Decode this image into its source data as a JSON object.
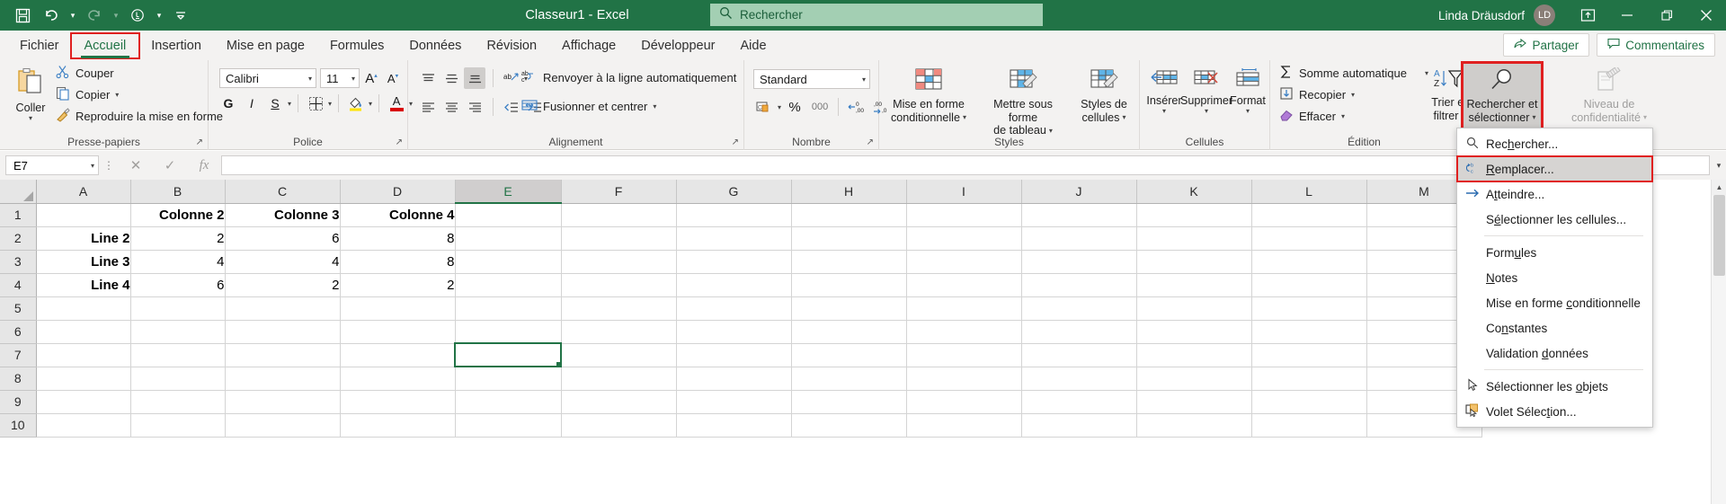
{
  "titlebar": {
    "quick_access": [
      {
        "name": "save-icon",
        "glyph": "὚B"
      },
      {
        "name": "undo-icon",
        "glyph": "↶"
      },
      {
        "name": "redo-icon",
        "glyph": "↷"
      },
      {
        "name": "touch-mode-icon",
        "glyph": "☝"
      },
      {
        "name": "customize-qat-icon",
        "glyph": "⌄"
      }
    ],
    "document_title": "Classeur1  -  Excel",
    "search_placeholder": "Rechercher",
    "user_name": "Linda Dräusdorf",
    "user_initials": "LD",
    "window_buttons": [
      "ribbon-display",
      "minimize",
      "restore",
      "close"
    ]
  },
  "tabs": [
    {
      "label": "Fichier",
      "active": false,
      "highlighted": false
    },
    {
      "label": "Accueil",
      "active": true,
      "highlighted": true
    },
    {
      "label": "Insertion",
      "active": false,
      "highlighted": false
    },
    {
      "label": "Mise en page",
      "active": false,
      "highlighted": false
    },
    {
      "label": "Formules",
      "active": false,
      "highlighted": false
    },
    {
      "label": "Données",
      "active": false,
      "highlighted": false
    },
    {
      "label": "Révision",
      "active": false,
      "highlighted": false
    },
    {
      "label": "Affichage",
      "active": false,
      "highlighted": false
    },
    {
      "label": "Développeur",
      "active": false,
      "highlighted": false
    },
    {
      "label": "Aide",
      "active": false,
      "highlighted": false
    }
  ],
  "tab_actions": {
    "share_label": "Partager",
    "comments_label": "Commentaires"
  },
  "ribbon": {
    "clipboard": {
      "group_label": "Presse-papiers",
      "paste_label": "Coller",
      "cut_label": "Couper",
      "copy_label": "Copier",
      "format_painter_label": "Reproduire la mise en forme"
    },
    "font": {
      "group_label": "Police",
      "font_family": "Calibri",
      "font_size": "11",
      "grow_font": "A",
      "shrink_font": "A",
      "bold": "G",
      "italic": "I",
      "underline": "S",
      "borders": "borders-icon",
      "fill_color": "fill-color-icon",
      "font_color": "A"
    },
    "alignment": {
      "group_label": "Alignement",
      "wrap_text_label": "Renvoyer à la ligne automatiquement",
      "merge_label": "Fusionner et centrer"
    },
    "number": {
      "group_label": "Nombre",
      "format": "Standard",
      "percent": "%",
      "thousands": "000",
      "decrease_decimal": "decrease-decimal-icon",
      "increase_decimal": "increase-decimal-icon"
    },
    "styles": {
      "group_label": "Styles",
      "conditional_formatting": "Mise en forme\nconditionnelle",
      "conditional_formatting_l1": "Mise en forme",
      "conditional_formatting_l2": "conditionnelle",
      "format_as_table_l1": "Mettre sous forme",
      "format_as_table_l2": "de tableau",
      "cell_styles_l1": "Styles de",
      "cell_styles_l2": "cellules"
    },
    "cells": {
      "group_label": "Cellules",
      "insert_label": "Insérer",
      "delete_label": "Supprimer",
      "format_label": "Format"
    },
    "editing": {
      "group_label": "Édition",
      "autosum_label": "Somme automatique",
      "fill_label": "Recopier",
      "clear_label": "Effacer",
      "sort_filter_l1": "Trier et",
      "sort_filter_l2": "filtrer",
      "find_select_l1": "Rechercher et",
      "find_select_l2": "sélectionner"
    },
    "sensitivity": {
      "label_l1": "Niveau de",
      "label_l2": "confidentialité"
    }
  },
  "formula_bar": {
    "name_box_value": "E7",
    "cancel_icon": "✕",
    "confirm_icon": "✓",
    "function_icon": "fx",
    "formula_value": ""
  },
  "find_menu": {
    "items": [
      {
        "label": "Rechercher...",
        "icon": "search-icon",
        "highlighted": false,
        "separator_after": false
      },
      {
        "label": "Remplacer...",
        "icon": "replace-icon",
        "highlighted": true,
        "separator_after": false
      },
      {
        "label": "Atteindre...",
        "icon": "goto-arrow-icon",
        "highlighted": false,
        "separator_after": false
      },
      {
        "label": "Sélectionner les cellules...",
        "icon": "",
        "highlighted": false,
        "separator_after": true
      },
      {
        "label": "Formules",
        "icon": "",
        "highlighted": false,
        "separator_after": false
      },
      {
        "label": "Notes",
        "icon": "",
        "highlighted": false,
        "separator_after": false
      },
      {
        "label": "Mise en forme conditionnelle",
        "icon": "",
        "highlighted": false,
        "separator_after": false
      },
      {
        "label": "Constantes",
        "icon": "",
        "highlighted": false,
        "separator_after": false
      },
      {
        "label": "Validation données",
        "icon": "",
        "highlighted": false,
        "separator_after": true
      },
      {
        "label": "Sélectionner les objets",
        "icon": "pointer-icon",
        "highlighted": false,
        "separator_after": false
      },
      {
        "label": "Volet Sélection...",
        "icon": "selection-pane-icon",
        "highlighted": false,
        "separator_after": false
      }
    ]
  },
  "grid": {
    "columns": [
      "A",
      "B",
      "C",
      "D",
      "E",
      "F",
      "G",
      "H",
      "I",
      "J",
      "K",
      "L",
      "M"
    ],
    "active_column": "E",
    "rows": [
      "1",
      "2",
      "3",
      "4",
      "5",
      "6",
      "7",
      "8",
      "9",
      "10"
    ],
    "selected_cell": "E7",
    "cells": [
      {
        "row": "1",
        "A": "",
        "B": "Colonne 2",
        "C": "Colonne 3",
        "D": "Colonne 4"
      },
      {
        "row": "2",
        "A": "Line 2",
        "B": "2",
        "C": "6",
        "D": "8"
      },
      {
        "row": "3",
        "A": "Line 3",
        "B": "4",
        "C": "4",
        "D": "8"
      },
      {
        "row": "4",
        "A": "Line 4",
        "B": "6",
        "C": "2",
        "D": "2"
      },
      {
        "row": "5",
        "A": "",
        "B": "",
        "C": "",
        "D": ""
      },
      {
        "row": "6",
        "A": "",
        "B": "",
        "C": "",
        "D": ""
      },
      {
        "row": "7",
        "A": "",
        "B": "",
        "C": "",
        "D": ""
      },
      {
        "row": "8",
        "A": "",
        "B": "",
        "C": "",
        "D": ""
      },
      {
        "row": "9",
        "A": "",
        "B": "",
        "C": "",
        "D": ""
      },
      {
        "row": "10",
        "A": "",
        "B": "",
        "C": "",
        "D": ""
      }
    ]
  },
  "colors": {
    "excel_green": "#217346",
    "ribbon_bg": "#f3f2f1",
    "highlight_red": "#e02020",
    "search_bg": "#a3cfb3"
  }
}
